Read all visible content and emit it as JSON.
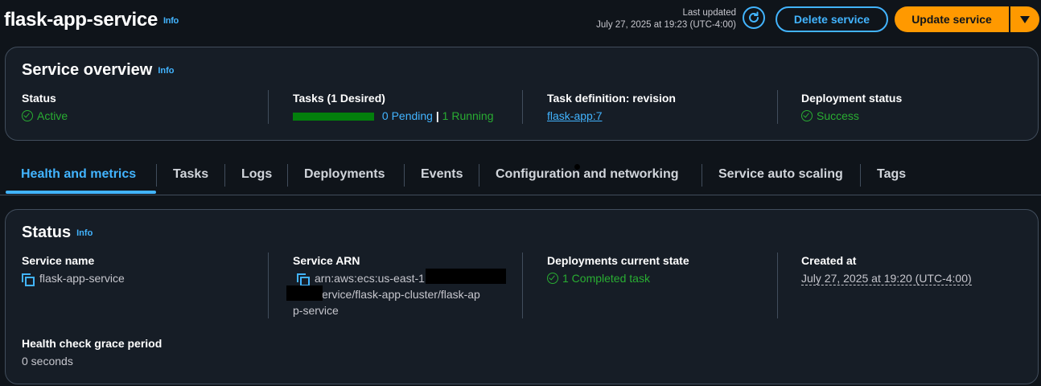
{
  "header": {
    "title": "flask-app-service",
    "info": "Info",
    "last_updated_label": "Last updated",
    "last_updated_value": "July 27, 2025 at 19:23 (UTC-4:00)",
    "refresh_icon": "refresh-icon",
    "delete_label": "Delete service",
    "update_label": "Update service"
  },
  "overview": {
    "title": "Service overview",
    "info": "Info",
    "status_label": "Status",
    "status_value": "Active",
    "tasks_label": "Tasks (1 Desired)",
    "tasks_running_fraction": 1.0,
    "tasks_pending": "0 Pending",
    "tasks_sep": "|",
    "tasks_running": "1 Running",
    "taskdef_label": "Task definition: revision",
    "taskdef_value": "flask-app:7",
    "deploy_label": "Deployment status",
    "deploy_value": "Success"
  },
  "tabs": [
    {
      "label": "Health and metrics",
      "active": true
    },
    {
      "label": "Tasks"
    },
    {
      "label": "Logs"
    },
    {
      "label": "Deployments"
    },
    {
      "label": "Events"
    },
    {
      "label": "Configuration and networking"
    },
    {
      "label": "Service auto scaling"
    },
    {
      "label": "Tags"
    }
  ],
  "status": {
    "title": "Status",
    "info": "Info",
    "service_name_label": "Service name",
    "service_name_value": "flask-app-service",
    "arn_label": "Service ARN",
    "arn_line1": "arn:aws:ecs:us-east-1",
    "arn_line2": "ervice/flask-app-cluster/flask-ap",
    "arn_line3": "p-service",
    "deploy_state_label": "Deployments current state",
    "deploy_state_value": "1 Completed task",
    "created_label": "Created at",
    "created_value": "July 27, 2025 at 19:20 (UTC-4:00)",
    "grace_label": "Health check grace period",
    "grace_value": "0 seconds"
  },
  "colors": {
    "accent": "#42b4ff",
    "primary_button": "#ff9900",
    "success": "#29ad32",
    "background": "#0f141a"
  }
}
